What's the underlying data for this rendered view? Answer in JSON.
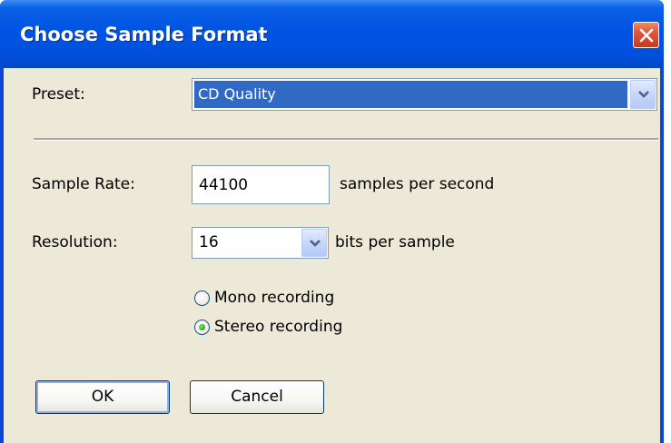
{
  "window": {
    "title": "Choose Sample Format"
  },
  "preset": {
    "label": "Preset:",
    "value": "CD Quality"
  },
  "sample_rate": {
    "label": "Sample Rate:",
    "value": "44100",
    "unit": "samples per second"
  },
  "resolution": {
    "label": "Resolution:",
    "value": "16",
    "unit": "bits per sample"
  },
  "channels": {
    "options": [
      {
        "label": "Mono recording",
        "checked": false
      },
      {
        "label": "Stereo recording",
        "checked": true
      }
    ]
  },
  "buttons": {
    "ok": "OK",
    "cancel": "Cancel"
  },
  "colors": {
    "titlebar": "#0054e3",
    "dialog_bg": "#ece9d8",
    "selection": "#316ac5",
    "close": "#e0553a"
  }
}
